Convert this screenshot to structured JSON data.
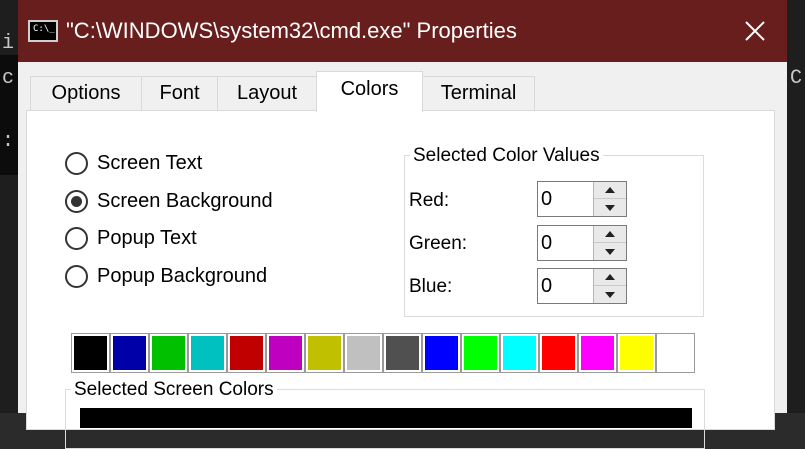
{
  "window": {
    "title": "\"C:\\WINDOWS\\system32\\cmd.exe\" Properties",
    "icon_text": "C:\\_",
    "title_bar_color": "#681e1c",
    "close_icon": "close-icon"
  },
  "tabs": [
    {
      "label": "Options",
      "active": false
    },
    {
      "label": "Font",
      "active": false
    },
    {
      "label": "Layout",
      "active": false
    },
    {
      "label": "Colors",
      "active": true
    },
    {
      "label": "Terminal",
      "active": false
    }
  ],
  "radios": [
    {
      "label": "Screen Text",
      "checked": false
    },
    {
      "label": "Screen Background",
      "checked": true
    },
    {
      "label": "Popup Text",
      "checked": false
    },
    {
      "label": "Popup Background",
      "checked": false
    }
  ],
  "selected_color_values": {
    "title": "Selected Color Values",
    "fields": [
      {
        "label": "Red:",
        "value": "0"
      },
      {
        "label": "Green:",
        "value": "0"
      },
      {
        "label": "Blue:",
        "value": "0"
      }
    ]
  },
  "palette": [
    "#000000",
    "#0000a8",
    "#00c000",
    "#00c0c0",
    "#c00000",
    "#c000c0",
    "#c0c000",
    "#c0c0c0",
    "#505050",
    "#0000ff",
    "#00ff00",
    "#00ffff",
    "#ff0000",
    "#ff00ff",
    "#ffff00",
    "#ffffff"
  ],
  "selected_screen_colors": {
    "title": "Selected Screen Colors"
  },
  "background_console": {
    "glyphs": [
      "i",
      "c",
      ":",
      "C"
    ]
  }
}
